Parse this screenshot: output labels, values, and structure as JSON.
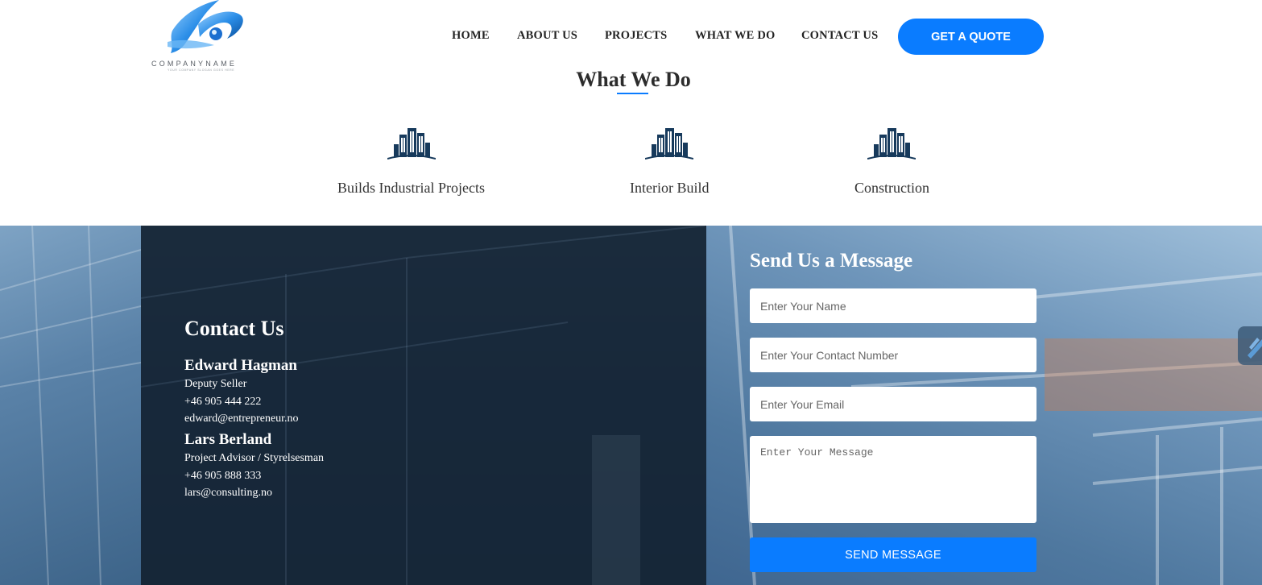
{
  "header": {
    "logo": {
      "name": "COMPANYNAME",
      "tagline": "YOUR COMPANY SLOGAN GOES HERE"
    },
    "nav": [
      "HOME",
      "ABOUT US",
      "PROJECTS",
      "WHAT WE DO",
      "CONTACT US"
    ],
    "quote_button": "GET A QUOTE"
  },
  "what_we_do": {
    "title": "What We Do",
    "services": [
      {
        "label": "Builds Industrial Projects",
        "icon": "building-icon"
      },
      {
        "label": "Interior Build",
        "icon": "building-icon"
      },
      {
        "label": "Construction",
        "icon": "building-icon"
      }
    ]
  },
  "contact": {
    "title": "Contact Us",
    "people": [
      {
        "name": "Edward Hagman",
        "role": "Deputy Seller",
        "phone": "+46 905 444 222",
        "email": "edward@entrepreneur.no"
      },
      {
        "name": "Lars Berland",
        "role": "Project Advisor / Styrelsesman",
        "phone": "+46 905 888 333",
        "email": "lars@consulting.no"
      }
    ]
  },
  "message_form": {
    "title": "Send Us a Message",
    "name_placeholder": "Enter Your Name",
    "contact_placeholder": "Enter Your Contact Number",
    "email_placeholder": "Enter Your Email",
    "message_placeholder": "Enter Your Message",
    "send_button": "SEND MESSAGE"
  },
  "colors": {
    "accent": "#0a7cff",
    "dark_panel": "#122030",
    "heading": "#2c2c2c"
  }
}
